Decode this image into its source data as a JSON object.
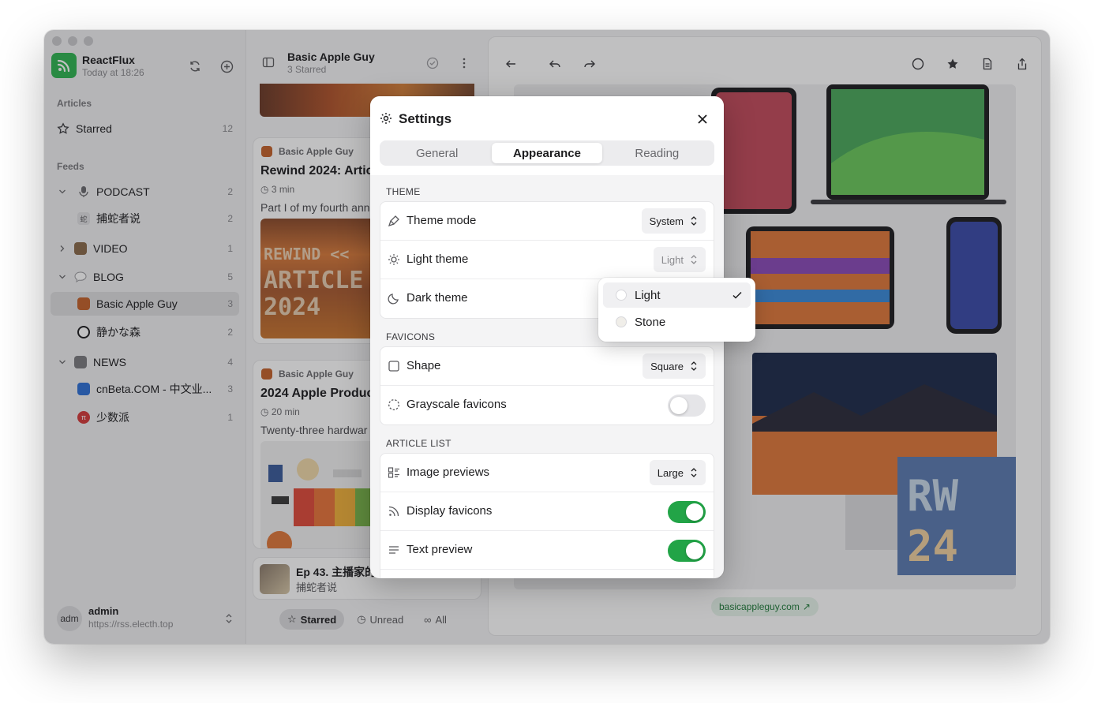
{
  "app": {
    "name": "ReactFlux",
    "subtitle": "Today at 18:26"
  },
  "sidebar": {
    "articles_label": "Articles",
    "starred": {
      "label": "Starred",
      "count": "12"
    },
    "feeds_label": "Feeds",
    "items": [
      {
        "label": "PODCAST",
        "count": "2"
      },
      {
        "label": "捕蛇者说",
        "count": "2"
      },
      {
        "label": "VIDEO",
        "count": "1"
      },
      {
        "label": "BLOG",
        "count": "5"
      },
      {
        "label": "Basic Apple Guy",
        "count": "3"
      },
      {
        "label": "静かな森",
        "count": "2"
      },
      {
        "label": "NEWS",
        "count": "4"
      },
      {
        "label": "cnBeta.COM - 中文业...",
        "count": "3"
      },
      {
        "label": "少数派",
        "count": "1"
      }
    ],
    "user": {
      "avatar": "adm",
      "name": "admin",
      "url": "https://rss.electh.top"
    }
  },
  "list": {
    "title": "Basic Apple Guy",
    "subtitle": "3 Starred",
    "cards": [
      {
        "feed": "Basic Apple Guy",
        "title": "Rewind 2024: Artic",
        "time": "3 min",
        "desc": "Part I of my fourth ann"
      },
      {
        "feed": "Basic Apple Guy",
        "title": "2024 Apple Produc",
        "time": "20 min",
        "desc": "Twenty-three hardwar"
      }
    ],
    "player": {
      "title": "Ep 43. 主播家的",
      "feed": "捕蛇者说"
    },
    "filters": {
      "starred": "Starred",
      "unread": "Unread",
      "all": "All"
    }
  },
  "reader": {
    "site": "basicappleguy.com"
  },
  "settings": {
    "title": "Settings",
    "tabs": [
      "General",
      "Appearance",
      "Reading"
    ],
    "theme": {
      "label": "THEME",
      "theme_mode": {
        "label": "Theme mode",
        "value": "System"
      },
      "light_theme": {
        "label": "Light theme",
        "value": "Light"
      },
      "dark_theme": {
        "label": "Dark theme"
      }
    },
    "favicons": {
      "label": "FAVICONS",
      "shape": {
        "label": "Shape",
        "value": "Square"
      },
      "grayscale": {
        "label": "Grayscale favicons",
        "on": false
      }
    },
    "article_list": {
      "label": "ARTICLE LIST",
      "image_previews": {
        "label": "Image previews",
        "value": "Large"
      },
      "display_favicons": {
        "label": "Display favicons",
        "on": true
      },
      "text_preview": {
        "label": "Text preview",
        "on": true
      }
    },
    "popup": {
      "options": [
        "Light",
        "Stone"
      ],
      "selected": "Light"
    }
  },
  "colors": {
    "accent": "#22a447",
    "brand": "#2fb551"
  }
}
